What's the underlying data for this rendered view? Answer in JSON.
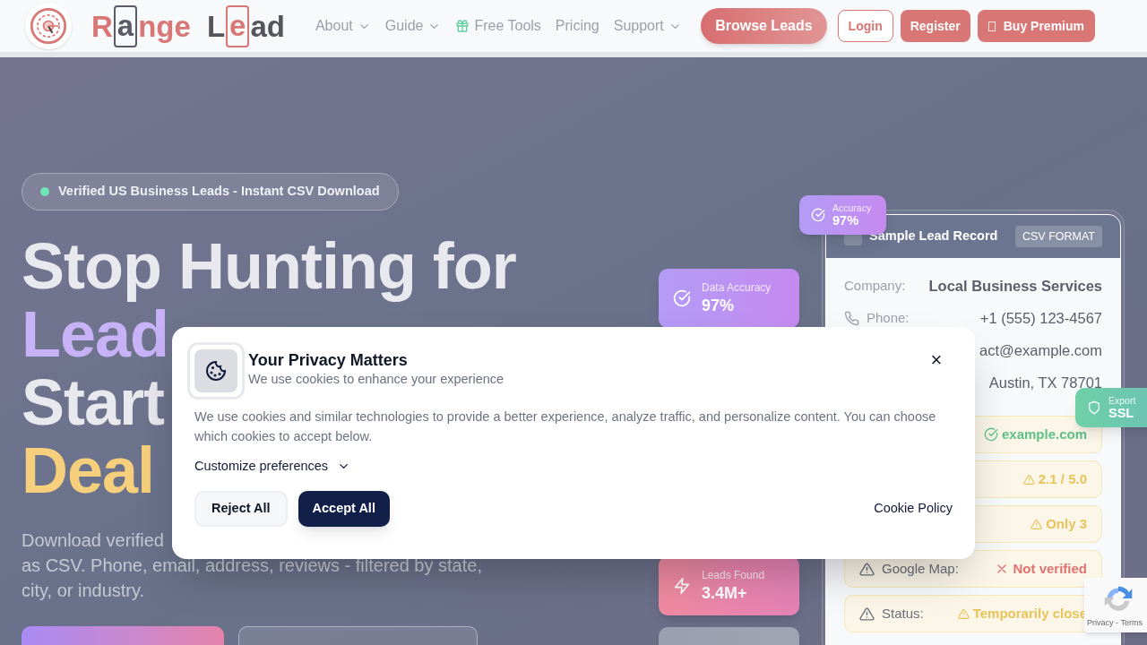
{
  "header": {
    "logo": {
      "words": [
        [
          {
            "text": "R",
            "boxed": false,
            "color": "#d97676"
          },
          {
            "text": "a",
            "boxed": true,
            "color": "#5b5b68"
          },
          {
            "text": "nge",
            "boxed": false,
            "color": "#d97676"
          }
        ],
        [
          {
            "text": "L",
            "boxed": false,
            "color": "#55555c"
          },
          {
            "text": "e",
            "boxed": true,
            "color": "#d97676"
          },
          {
            "text": "ad",
            "boxed": false,
            "color": "#55555c"
          }
        ]
      ]
    },
    "nav": [
      {
        "label": "About",
        "kind": "dropdown"
      },
      {
        "label": "Guide",
        "kind": "dropdown"
      },
      {
        "label": "Free Tools",
        "kind": "gift"
      },
      {
        "label": "Pricing",
        "kind": "link"
      },
      {
        "label": "Support",
        "kind": "dropdown"
      }
    ],
    "buttons": [
      {
        "label": "Browse Leads",
        "kind": "pill"
      },
      {
        "label": "Login",
        "kind": "outline"
      },
      {
        "label": "Register",
        "kind": "solid"
      },
      {
        "label": "Buy Premium",
        "kind": "icon"
      }
    ]
  },
  "hero": {
    "badge": "Verified US Business Leads - Instant CSV Download",
    "headline": [
      {
        "text": "Stop Hunting for",
        "color": "#e8e9ee"
      },
      {
        "text": "Lead",
        "color": "#c7b2f7"
      },
      {
        "text": "Start",
        "color": "#e8e9ee"
      },
      {
        "text": "Deal",
        "color": "#f6cf7c"
      }
    ],
    "description": [
      "Download verified",
      "as CSV. Phone, email, address, reviews - filtered by state, city, or industry."
    ],
    "actions": [
      {
        "kind": "primary"
      },
      {
        "kind": "secondary"
      }
    ]
  },
  "stats": [
    {
      "label": "Data Accuracy",
      "value": "97%",
      "kind": "check"
    },
    {
      "label": "Leads Found",
      "value": "3.4M+",
      "kind": "zap"
    },
    {
      "kind": "muted"
    }
  ],
  "record": {
    "title": "Sample Lead Record",
    "tag": "CSV FORMAT",
    "rows": [
      {
        "kind": "plain",
        "label": "Company:",
        "value": "Local Business Services"
      },
      {
        "kind": "phone",
        "label": "Phone:",
        "value": "+1 (555) 123-4567"
      },
      {
        "kind": "plain",
        "value": "act@example.com"
      },
      {
        "kind": "plain",
        "value": "Austin, TX 78701"
      },
      {
        "kind": "ok",
        "value": "example.com"
      },
      {
        "kind": "warn",
        "value": "2.1 / 5.0"
      },
      {
        "kind": "warn",
        "value": "Only 3"
      },
      {
        "kind": "bad",
        "label": "Google Map:",
        "value": "Not verified"
      },
      {
        "kind": "warn",
        "label": "Status:",
        "value": "Temporarily close"
      }
    ],
    "badges": [
      {
        "label": "Accuracy",
        "value": "97%",
        "kind": "check"
      },
      {
        "label": "Export",
        "value": "SSL",
        "kind": "shield"
      }
    ]
  },
  "cookie_dialog": {
    "title": "Your Privacy Matters",
    "subtitle": "We use cookies to enhance your experience",
    "body": "We use cookies and similar technologies to provide a better experience, analyze traffic, and personalize content. You can choose which cookies to accept below.",
    "customize": "Customize preferences",
    "buttons": [
      {
        "label": "Reject All",
        "kind": "secondary"
      },
      {
        "label": "Accept All",
        "kind": "primary"
      }
    ],
    "policy_link": "Cookie Policy",
    "close": "×"
  },
  "recaptcha": {
    "text": "Privacy - Terms"
  }
}
